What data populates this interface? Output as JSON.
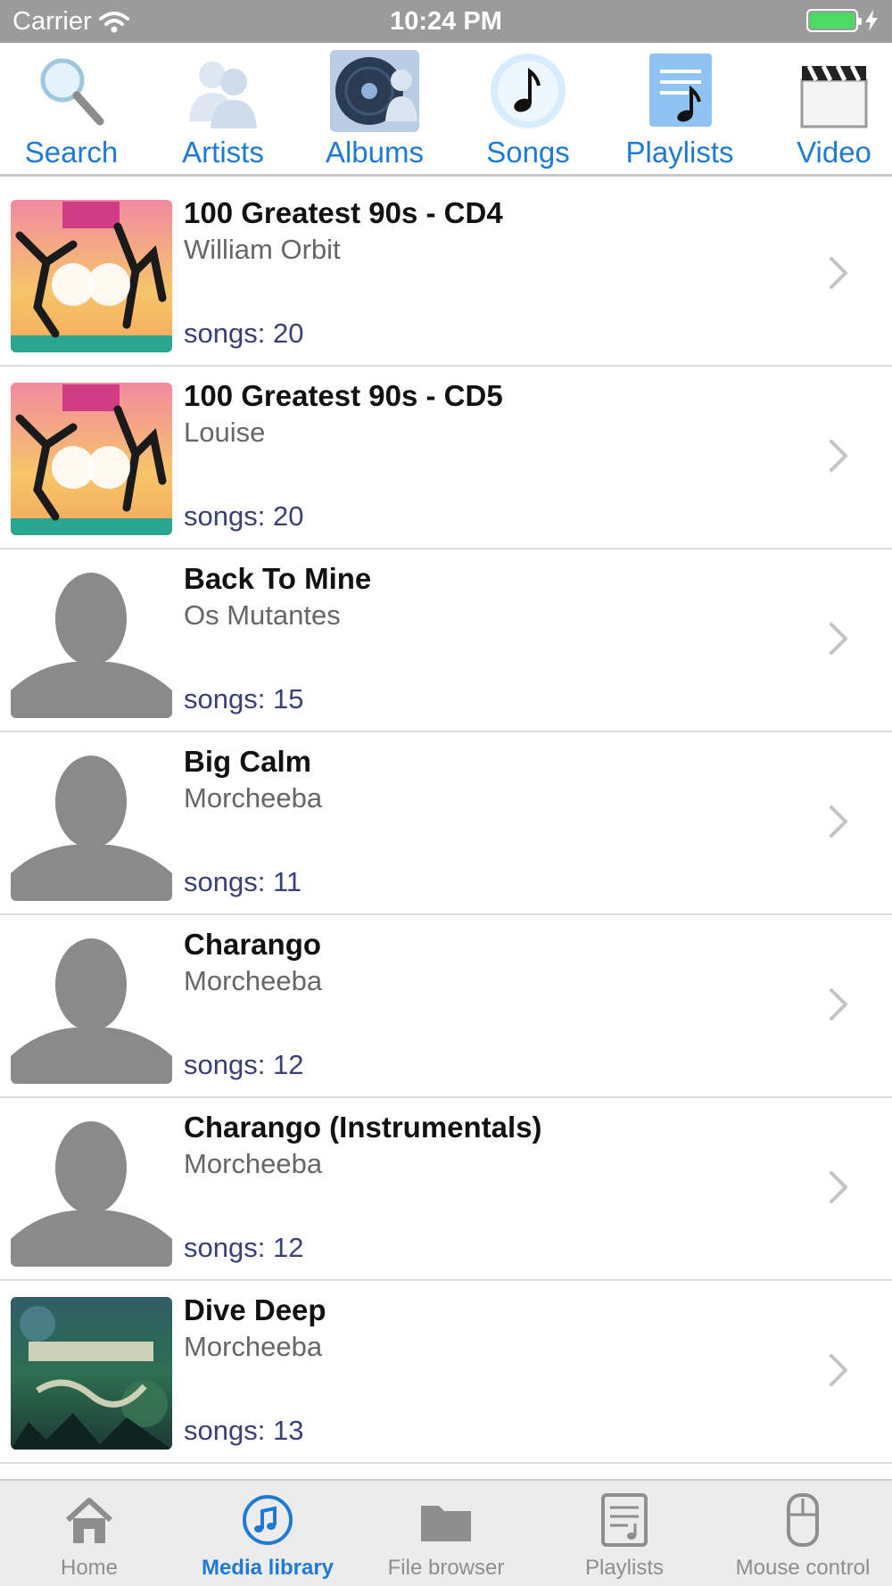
{
  "status_bar": {
    "carrier": "Carrier",
    "time": "10:24 PM"
  },
  "top_tabs": [
    {
      "label": "Search",
      "icon": "search-icon"
    },
    {
      "label": "Artists",
      "icon": "artists-icon"
    },
    {
      "label": "Albums",
      "icon": "albums-icon",
      "selected": true
    },
    {
      "label": "Songs",
      "icon": "songs-icon"
    },
    {
      "label": "Playlists",
      "icon": "playlists-icon"
    },
    {
      "label": "Video",
      "icon": "video-icon"
    }
  ],
  "albums": [
    {
      "title": "100 Greatest 90s - CD4",
      "artist": "William Orbit",
      "count": "songs: 20",
      "art": "90s-compilation-cover"
    },
    {
      "title": "100 Greatest 90s - CD5",
      "artist": "Louise",
      "count": "songs: 20",
      "art": "90s-compilation-cover"
    },
    {
      "title": "Back To Mine",
      "artist": "Os Mutantes",
      "count": "songs: 15",
      "art": "placeholder-silhouette"
    },
    {
      "title": "Big Calm",
      "artist": "Morcheeba",
      "count": "songs: 11",
      "art": "placeholder-silhouette"
    },
    {
      "title": "Charango",
      "artist": "Morcheeba",
      "count": "songs: 12",
      "art": "placeholder-silhouette"
    },
    {
      "title": "Charango (Instrumentals)",
      "artist": "Morcheeba",
      "count": "songs: 12",
      "art": "placeholder-silhouette"
    },
    {
      "title": "Dive Deep",
      "artist": "Morcheeba",
      "count": "songs: 13",
      "art": "dive-deep-cover"
    }
  ],
  "bottom_tabs": [
    {
      "label": "Home",
      "icon": "home-icon"
    },
    {
      "label": "Media library",
      "icon": "music-note-icon",
      "active": true
    },
    {
      "label": "File browser",
      "icon": "folder-icon"
    },
    {
      "label": "Playlists",
      "icon": "playlist-doc-icon"
    },
    {
      "label": "Mouse control",
      "icon": "mouse-icon"
    }
  ],
  "colors": {
    "accent": "#1f7ad6",
    "status_bar": "#9b9b9b",
    "song_count": "#3a3f78"
  }
}
